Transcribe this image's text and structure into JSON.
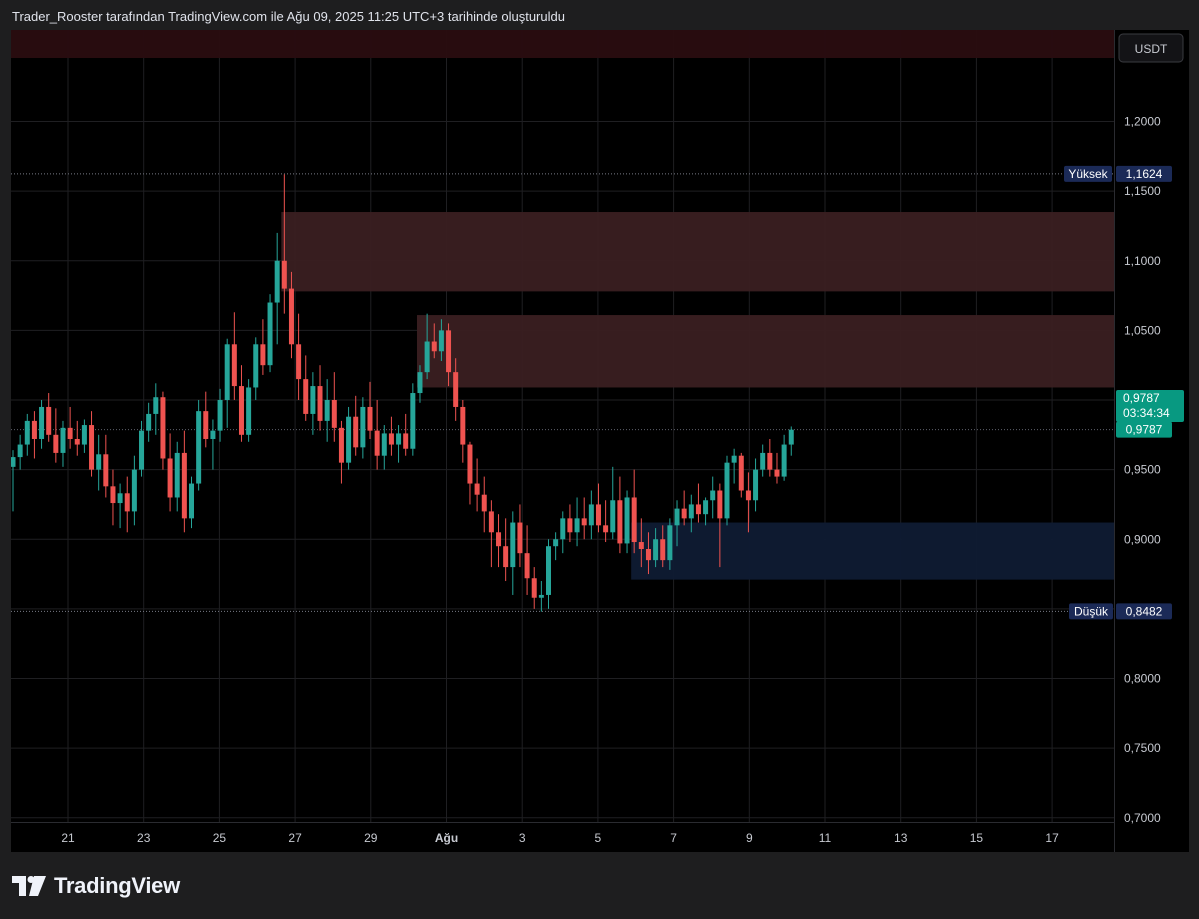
{
  "header": {
    "caption": "Trader_Rooster tarafından TradingView.com ile Ağu 09, 2025 11:25 UTC+3 tarihinde oluşturuldu"
  },
  "footer": {
    "brand": "TradingView"
  },
  "colors": {
    "up": "#26a69a",
    "down": "#ef5350",
    "background": "#000000",
    "grid": "#1f1f22",
    "supply_zone": "#3a1f21",
    "demand_zone": "#0f1b33",
    "top_band": "#2a0d10",
    "high_tag": "#1b2a57",
    "last_price_tag": "#089981"
  },
  "chart_data": {
    "type": "candlestick",
    "currency": "USDT",
    "ylim": [
      0.7,
      1.25
    ],
    "y_ticks": [
      "1,2000",
      "1,1500",
      "1,1000",
      "1,0500",
      "0,9500",
      "0,9000",
      "0,8000",
      "0,7500",
      "0,7000"
    ],
    "y_tick_values": [
      1.2,
      1.15,
      1.1,
      1.05,
      0.95,
      0.9,
      0.8,
      0.75,
      0.7
    ],
    "x_ticks": [
      "21",
      "23",
      "25",
      "27",
      "29",
      "Ağu",
      "3",
      "5",
      "7",
      "9",
      "11",
      "13",
      "15",
      "17"
    ],
    "high": {
      "label": "Yüksek",
      "value": "1,1624",
      "price": 1.1624
    },
    "low": {
      "label": "Düşük",
      "value": "0,8482",
      "price": 0.8482
    },
    "last_price": {
      "value": "0,9787",
      "countdown": "03:34:34",
      "value2": "0,9787",
      "price": 0.9787
    },
    "zones": [
      {
        "kind": "supply",
        "from_bar": 38,
        "top": 1.135,
        "bottom": 1.078
      },
      {
        "kind": "supply",
        "from_bar": 57,
        "top": 1.061,
        "bottom": 1.009
      },
      {
        "kind": "demand",
        "from_bar": 87,
        "top": 0.912,
        "bottom": 0.871
      },
      {
        "kind": "band",
        "from_bar": 0,
        "top": 1.257,
        "bottom": 1.237
      }
    ],
    "candles": [
      [
        0.952,
        0.964,
        0.92,
        0.959
      ],
      [
        0.959,
        0.975,
        0.95,
        0.968
      ],
      [
        0.968,
        0.99,
        0.96,
        0.985
      ],
      [
        0.985,
        0.992,
        0.958,
        0.972
      ],
      [
        0.972,
        1.0,
        0.965,
        0.995
      ],
      [
        0.995,
        1.005,
        0.97,
        0.975
      ],
      [
        0.975,
        0.994,
        0.955,
        0.962
      ],
      [
        0.962,
        0.985,
        0.952,
        0.98
      ],
      [
        0.98,
        0.995,
        0.965,
        0.972
      ],
      [
        0.972,
        0.985,
        0.96,
        0.968
      ],
      [
        0.968,
        0.986,
        0.962,
        0.982
      ],
      [
        0.982,
        0.992,
        0.945,
        0.95
      ],
      [
        0.95,
        0.975,
        0.935,
        0.961
      ],
      [
        0.961,
        0.975,
        0.93,
        0.938
      ],
      [
        0.938,
        0.95,
        0.91,
        0.926
      ],
      [
        0.926,
        0.94,
        0.908,
        0.933
      ],
      [
        0.933,
        0.945,
        0.905,
        0.92
      ],
      [
        0.92,
        0.96,
        0.91,
        0.95
      ],
      [
        0.95,
        0.985,
        0.945,
        0.978
      ],
      [
        0.978,
        0.998,
        0.97,
        0.99
      ],
      [
        0.99,
        1.012,
        0.975,
        1.002
      ],
      [
        1.002,
        1.006,
        0.95,
        0.958
      ],
      [
        0.958,
        0.976,
        0.92,
        0.93
      ],
      [
        0.93,
        0.97,
        0.92,
        0.962
      ],
      [
        0.962,
        0.978,
        0.905,
        0.915
      ],
      [
        0.915,
        0.945,
        0.908,
        0.94
      ],
      [
        0.94,
        1.0,
        0.935,
        0.992
      ],
      [
        0.992,
        1.006,
        0.966,
        0.972
      ],
      [
        0.972,
        0.986,
        0.95,
        0.978
      ],
      [
        0.978,
        1.008,
        0.97,
        1.0
      ],
      [
        1.0,
        1.044,
        0.98,
        1.04
      ],
      [
        1.04,
        1.063,
        1.0,
        1.01
      ],
      [
        1.01,
        1.025,
        0.97,
        0.975
      ],
      [
        0.975,
        1.015,
        0.97,
        1.009
      ],
      [
        1.009,
        1.045,
        1.0,
        1.04
      ],
      [
        1.04,
        1.058,
        1.018,
        1.025
      ],
      [
        1.025,
        1.076,
        1.02,
        1.07
      ],
      [
        1.07,
        1.12,
        1.04,
        1.1
      ],
      [
        1.1,
        1.162,
        1.062,
        1.08
      ],
      [
        1.08,
        1.092,
        1.03,
        1.04
      ],
      [
        1.04,
        1.062,
        1.0,
        1.015
      ],
      [
        1.015,
        1.032,
        0.985,
        0.99
      ],
      [
        0.99,
        1.02,
        0.975,
        1.01
      ],
      [
        1.01,
        1.025,
        0.978,
        0.985
      ],
      [
        0.985,
        1.015,
        0.97,
        1.0
      ],
      [
        1.0,
        1.02,
        0.97,
        0.98
      ],
      [
        0.98,
        0.985,
        0.94,
        0.955
      ],
      [
        0.955,
        0.995,
        0.95,
        0.988
      ],
      [
        0.988,
        1.003,
        0.96,
        0.966
      ],
      [
        0.966,
        1.002,
        0.958,
        0.995
      ],
      [
        0.995,
        1.013,
        0.972,
        0.978
      ],
      [
        0.978,
        1.0,
        0.95,
        0.96
      ],
      [
        0.96,
        0.982,
        0.95,
        0.976
      ],
      [
        0.976,
        0.988,
        0.96,
        0.968
      ],
      [
        0.968,
        0.982,
        0.955,
        0.976
      ],
      [
        0.976,
        0.99,
        0.96,
        0.965
      ],
      [
        0.965,
        1.012,
        0.96,
        1.005
      ],
      [
        1.005,
        1.025,
        0.998,
        1.02
      ],
      [
        1.02,
        1.062,
        1.015,
        1.042
      ],
      [
        1.042,
        1.055,
        1.03,
        1.035
      ],
      [
        1.035,
        1.058,
        1.028,
        1.05
      ],
      [
        1.05,
        1.055,
        1.01,
        1.02
      ],
      [
        1.02,
        1.03,
        0.985,
        0.995
      ],
      [
        0.995,
        1.0,
        0.955,
        0.968
      ],
      [
        0.968,
        0.97,
        0.925,
        0.94
      ],
      [
        0.94,
        0.958,
        0.92,
        0.932
      ],
      [
        0.932,
        0.945,
        0.905,
        0.92
      ],
      [
        0.92,
        0.928,
        0.88,
        0.905
      ],
      [
        0.905,
        0.918,
        0.88,
        0.895
      ],
      [
        0.895,
        0.915,
        0.87,
        0.88
      ],
      [
        0.88,
        0.92,
        0.86,
        0.912
      ],
      [
        0.912,
        0.925,
        0.88,
        0.89
      ],
      [
        0.89,
        0.91,
        0.86,
        0.872
      ],
      [
        0.872,
        0.88,
        0.85,
        0.858
      ],
      [
        0.858,
        0.87,
        0.848,
        0.86
      ],
      [
        0.86,
        0.9,
        0.85,
        0.895
      ],
      [
        0.895,
        0.905,
        0.885,
        0.9
      ],
      [
        0.9,
        0.92,
        0.89,
        0.915
      ],
      [
        0.915,
        0.925,
        0.898,
        0.905
      ],
      [
        0.905,
        0.93,
        0.895,
        0.915
      ],
      [
        0.915,
        0.93,
        0.9,
        0.91
      ],
      [
        0.91,
        0.935,
        0.9,
        0.925
      ],
      [
        0.925,
        0.94,
        0.905,
        0.91
      ],
      [
        0.91,
        0.928,
        0.898,
        0.905
      ],
      [
        0.905,
        0.952,
        0.9,
        0.928
      ],
      [
        0.928,
        0.945,
        0.89,
        0.897
      ],
      [
        0.897,
        0.935,
        0.89,
        0.93
      ],
      [
        0.93,
        0.95,
        0.89,
        0.898
      ],
      [
        0.898,
        0.915,
        0.88,
        0.893
      ],
      [
        0.893,
        0.905,
        0.875,
        0.885
      ],
      [
        0.885,
        0.908,
        0.88,
        0.9
      ],
      [
        0.9,
        0.91,
        0.88,
        0.885
      ],
      [
        0.885,
        0.915,
        0.878,
        0.91
      ],
      [
        0.91,
        0.928,
        0.895,
        0.922
      ],
      [
        0.922,
        0.935,
        0.91,
        0.915
      ],
      [
        0.915,
        0.932,
        0.905,
        0.925
      ],
      [
        0.925,
        0.94,
        0.912,
        0.918
      ],
      [
        0.918,
        0.93,
        0.91,
        0.928
      ],
      [
        0.928,
        0.945,
        0.915,
        0.935
      ],
      [
        0.935,
        0.94,
        0.88,
        0.915
      ],
      [
        0.915,
        0.96,
        0.91,
        0.955
      ],
      [
        0.955,
        0.965,
        0.94,
        0.96
      ],
      [
        0.96,
        0.962,
        0.93,
        0.935
      ],
      [
        0.935,
        0.948,
        0.905,
        0.928
      ],
      [
        0.928,
        0.958,
        0.92,
        0.95
      ],
      [
        0.95,
        0.968,
        0.945,
        0.962
      ],
      [
        0.962,
        0.972,
        0.945,
        0.95
      ],
      [
        0.95,
        0.962,
        0.94,
        0.945
      ],
      [
        0.945,
        0.975,
        0.942,
        0.968
      ],
      [
        0.968,
        0.981,
        0.96,
        0.9787
      ]
    ]
  }
}
